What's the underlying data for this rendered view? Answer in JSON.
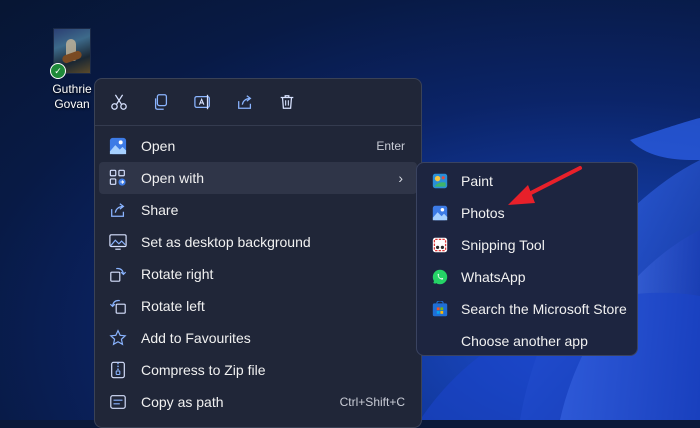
{
  "desktop_file": {
    "name": "Guthrie Govan"
  },
  "context_menu": {
    "toolbar": [
      {
        "icon": "cut-icon"
      },
      {
        "icon": "copy-icon"
      },
      {
        "icon": "rename-icon"
      },
      {
        "icon": "share-icon"
      },
      {
        "icon": "delete-icon"
      }
    ],
    "items": [
      {
        "label": "Open",
        "shortcut": "Enter",
        "icon": "photos-app-icon"
      },
      {
        "label": "Open with",
        "shortcut": "",
        "icon": "open-with-icon",
        "has_submenu": true
      },
      {
        "label": "Share",
        "shortcut": "",
        "icon": "share-icon"
      },
      {
        "label": "Set as desktop background",
        "shortcut": "",
        "icon": "desktop-background-icon"
      },
      {
        "label": "Rotate right",
        "shortcut": "",
        "icon": "rotate-right-icon"
      },
      {
        "label": "Rotate left",
        "shortcut": "",
        "icon": "rotate-left-icon"
      },
      {
        "label": "Add to Favourites",
        "shortcut": "",
        "icon": "star-icon"
      },
      {
        "label": "Compress to Zip file",
        "shortcut": "",
        "icon": "zip-icon"
      },
      {
        "label": "Copy as path",
        "shortcut": "Ctrl+Shift+C",
        "icon": "copy-path-icon"
      }
    ]
  },
  "open_with_submenu": {
    "items": [
      {
        "label": "Paint",
        "icon": "paint-icon"
      },
      {
        "label": "Photos",
        "icon": "photos-app-icon"
      },
      {
        "label": "Snipping Tool",
        "icon": "snipping-tool-icon"
      },
      {
        "label": "WhatsApp",
        "icon": "whatsapp-icon"
      },
      {
        "label": "Search the Microsoft Store",
        "icon": "microsoft-store-icon"
      },
      {
        "label": "Choose another app",
        "icon": ""
      }
    ]
  },
  "colors": {
    "menu_bg": "#202638",
    "submenu_bg": "#1d2540",
    "hover_bg": "#2f3548",
    "annotation_arrow": "#e8202a"
  }
}
